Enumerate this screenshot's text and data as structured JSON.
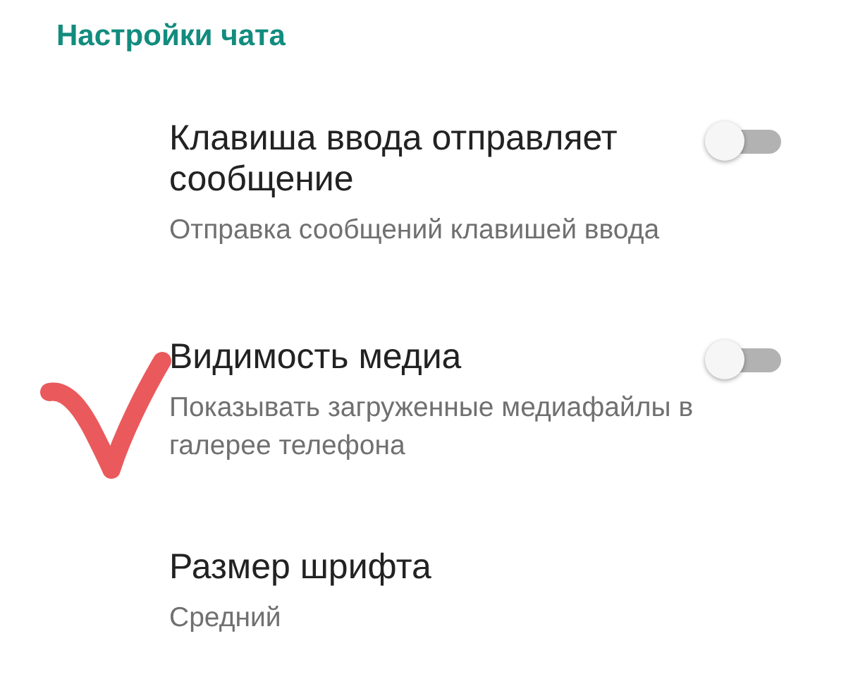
{
  "section": {
    "title": "Настройки чата"
  },
  "items": [
    {
      "kind": "toggle",
      "title": "Клавиша ввода отправляет сообщение",
      "subtitle": "Отправка сообщений клавишей ввода",
      "on": false
    },
    {
      "kind": "toggle",
      "title": "Видимость медиа",
      "subtitle": "Показывать загруженные медиафайлы в галерее телефона",
      "on": false
    },
    {
      "kind": "value",
      "title": "Размер шрифта",
      "subtitle": "Средний"
    }
  ]
}
